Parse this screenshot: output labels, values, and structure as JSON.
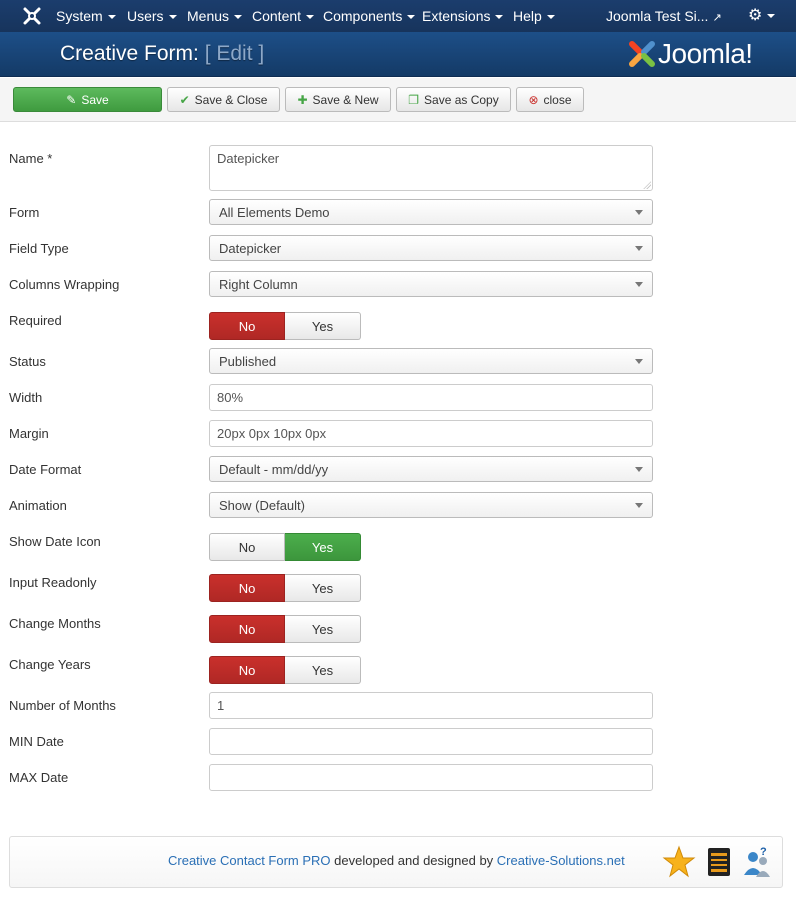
{
  "nav": {
    "items": [
      "System",
      "Users",
      "Menus",
      "Content",
      "Components",
      "Extensions",
      "Help"
    ],
    "site_name": "Joomla Test Si...",
    "icons": [
      "joomla-icon",
      "external-link-icon",
      "gear-icon"
    ]
  },
  "header": {
    "title": "Creative Form:",
    "title_suffix": "[ Edit ]",
    "brand": "Joomla!"
  },
  "toolbar": {
    "save": "Save",
    "save_close": "Save & Close",
    "save_new": "Save & New",
    "save_copy": "Save as Copy",
    "close": "close"
  },
  "form": {
    "name": {
      "label": "Name *",
      "value": "Datepicker"
    },
    "form": {
      "label": "Form",
      "value": "All Elements Demo"
    },
    "field_type": {
      "label": "Field Type",
      "value": "Datepicker"
    },
    "columns_wrapping": {
      "label": "Columns Wrapping",
      "value": "Right Column"
    },
    "required": {
      "label": "Required",
      "no": "No",
      "yes": "Yes",
      "selected": "No"
    },
    "status": {
      "label": "Status",
      "value": "Published"
    },
    "width": {
      "label": "Width",
      "value": "80%"
    },
    "margin": {
      "label": "Margin",
      "value": "20px 0px 10px 0px"
    },
    "date_format": {
      "label": "Date Format",
      "value": "Default - mm/dd/yy"
    },
    "animation": {
      "label": "Animation",
      "value": "Show (Default)"
    },
    "show_date_icon": {
      "label": "Show Date Icon",
      "no": "No",
      "yes": "Yes",
      "selected": "Yes"
    },
    "input_readonly": {
      "label": "Input Readonly",
      "no": "No",
      "yes": "Yes",
      "selected": "No"
    },
    "change_months": {
      "label": "Change Months",
      "no": "No",
      "yes": "Yes",
      "selected": "No"
    },
    "change_years": {
      "label": "Change Years",
      "no": "No",
      "yes": "Yes",
      "selected": "No"
    },
    "number_of_months": {
      "label": "Number of Months",
      "value": "1"
    },
    "min_date": {
      "label": "MIN Date",
      "value": ""
    },
    "max_date": {
      "label": "MAX Date",
      "value": ""
    }
  },
  "footer": {
    "product": "Creative Contact Form PRO",
    "middle": " developed and designed by ",
    "company": "Creative-Solutions.net",
    "icons": [
      "star-icon",
      "product-box-icon",
      "support-icon"
    ]
  },
  "colors": {
    "nav_bg": "#1b3d6d",
    "header_bg": "#1d4f88",
    "save_green": "#46a546",
    "toggle_red": "#bd362f",
    "toggle_green": "#46a546",
    "link_blue": "#2a6fb5"
  }
}
